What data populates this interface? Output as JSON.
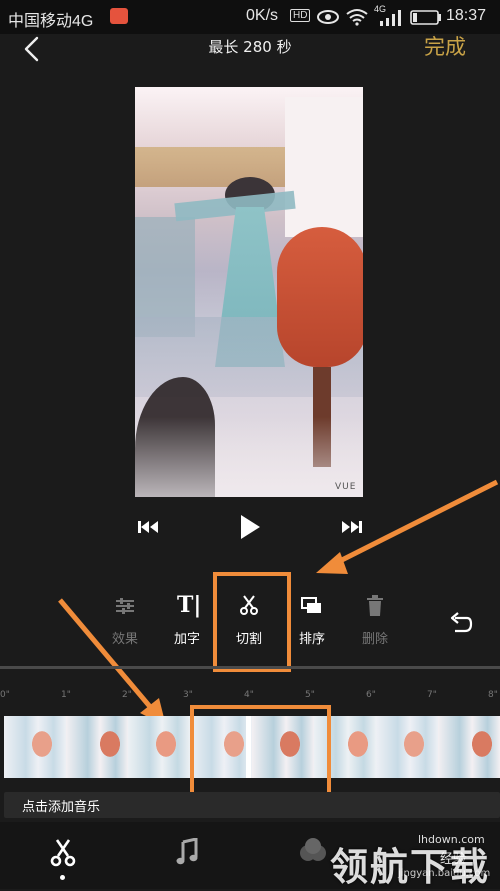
{
  "status_bar": {
    "carrier": "中国移动4G",
    "speed": "0K/s",
    "hd": "HD",
    "network": "4G",
    "time": "18:37"
  },
  "header": {
    "title": "最长 280 秒",
    "done_label": "完成"
  },
  "video": {
    "watermark": "VUE"
  },
  "toolbar": {
    "items": [
      {
        "label": "效果",
        "enabled": false
      },
      {
        "label": "加字",
        "enabled": true
      },
      {
        "label": "切割",
        "enabled": true,
        "highlighted": true
      },
      {
        "label": "排序",
        "enabled": true
      },
      {
        "label": "删除",
        "enabled": false
      }
    ]
  },
  "timeline": {
    "ticks": [
      "0\"",
      "1\"",
      "2\"",
      "3\"",
      "4\"",
      "5\"",
      "6\"",
      "7\"",
      "8\""
    ]
  },
  "music": {
    "label": "点击添加音乐"
  },
  "watermarks": {
    "site": "lhdown.com",
    "brand": "领航下载",
    "baidu": "jingyan.baidu.com",
    "experience": "经验"
  },
  "colors": {
    "accent_gold": "#c9a347",
    "annotation_orange": "#f08c3a",
    "background": "#1b1b1b"
  }
}
